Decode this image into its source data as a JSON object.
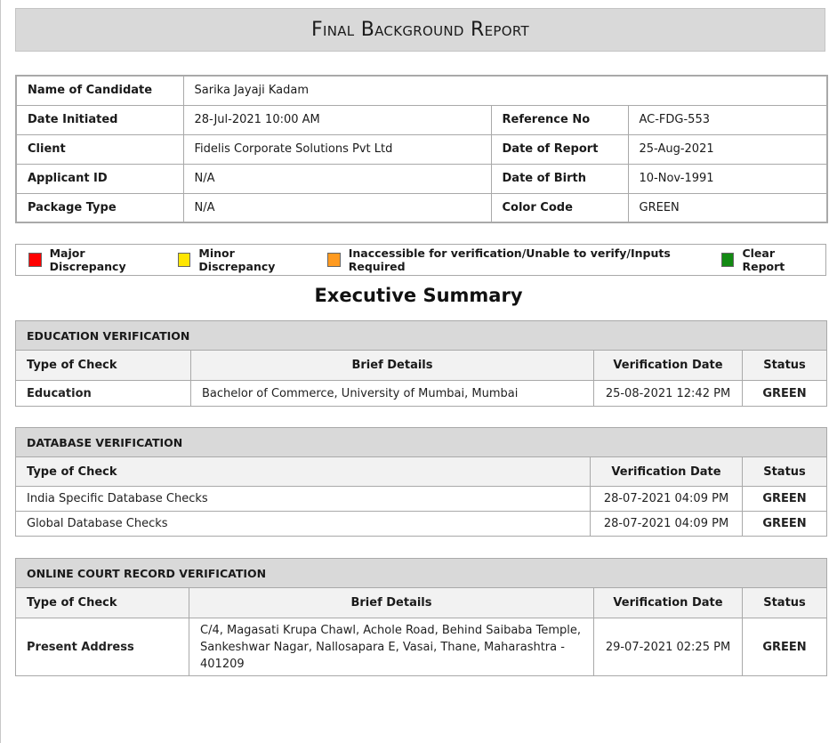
{
  "title": "Final Background Report",
  "candidate_info": {
    "name_label": "Name of Candidate",
    "name_value": "Sarika Jayaji Kadam",
    "date_initiated_label": "Date Initiated",
    "date_initiated_value": "28-Jul-2021 10:00 AM",
    "reference_label": "Reference No",
    "reference_value": "AC-FDG-553",
    "client_label": "Client",
    "client_value": "Fidelis Corporate Solutions Pvt Ltd",
    "date_of_report_label": "Date of Report",
    "date_of_report_value": "25-Aug-2021",
    "applicant_id_label": "Applicant ID",
    "applicant_id_value": "N/A",
    "dob_label": "Date of Birth",
    "dob_value": "10-Nov-1991",
    "package_label": "Package Type",
    "package_value": "N/A",
    "color_code_label": "Color Code",
    "color_code_value": "GREEN"
  },
  "legend": [
    {
      "label": "Major Discrepancy",
      "color": "#ff0000"
    },
    {
      "label": "Minor Discrepancy",
      "color": "#ffe600"
    },
    {
      "label": "Inaccessible for verification/Unable to verify/Inputs Required",
      "color": "#ff9a1f"
    },
    {
      "label": "Clear Report",
      "color": "#138a13"
    }
  ],
  "executive_summary_title": "Executive Summary",
  "education": {
    "heading": "EDUCATION VERIFICATION",
    "columns": [
      "Type of Check",
      "Brief Details",
      "Verification Date",
      "Status"
    ],
    "rows": [
      {
        "type": "Education",
        "details": "Bachelor of Commerce, University of Mumbai, Mumbai",
        "date": "25-08-2021 12:42 PM",
        "status": "GREEN"
      }
    ]
  },
  "database": {
    "heading": "DATABASE VERIFICATION",
    "columns": [
      "Type of Check",
      "Verification Date",
      "Status"
    ],
    "rows": [
      {
        "type": "India Specific Database Checks",
        "date": "28-07-2021 04:09 PM",
        "status": "GREEN"
      },
      {
        "type": "Global Database Checks",
        "date": "28-07-2021 04:09 PM",
        "status": "GREEN"
      }
    ]
  },
  "court": {
    "heading": "ONLINE COURT RECORD VERIFICATION",
    "columns": [
      "Type of Check",
      "Brief Details",
      "Verification Date",
      "Status"
    ],
    "rows": [
      {
        "type": "Present Address",
        "details": "C/4, Magasati Krupa Chawl, Achole Road, Behind Saibaba Temple, Sankeshwar Nagar, Nallosapara E, Vasai, Thane, Maharashtra - 401209",
        "date": "29-07-2021 02:25 PM",
        "status": "GREEN"
      }
    ]
  },
  "colors": {
    "status_green": "#128a12",
    "header_gray": "#d9d9d9"
  }
}
